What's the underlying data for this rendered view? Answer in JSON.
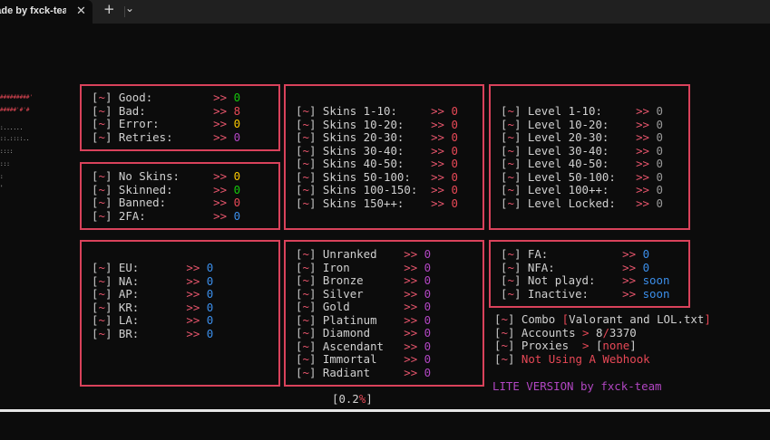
{
  "tab": {
    "title": "Tool made by fxck-team",
    "close": "✕",
    "new": "+",
    "dropdown": "⌄"
  },
  "ascii": {
    "red1": "#########'",
    "red2": "#####'#'#",
    "white": [
      ":......",
      "::.::::..",
      "::::",
      ":::",
      ":",
      "'"
    ]
  },
  "bracket_open": "[",
  "tilde": "~",
  "bracket_close": "]",
  "arrow": ">>",
  "stats": [
    {
      "label": "Good:",
      "value": "0",
      "color": "g"
    },
    {
      "label": "Bad:",
      "value": "8",
      "color": "r"
    },
    {
      "label": "Error:",
      "value": "0",
      "color": "y"
    },
    {
      "label": "Retries:",
      "value": "0",
      "color": "m"
    }
  ],
  "skins_status": [
    {
      "label": "No Skins:",
      "value": "0",
      "color": "y"
    },
    {
      "label": "Skinned:",
      "value": "0",
      "color": "g"
    },
    {
      "label": "Banned:",
      "value": "0",
      "color": "r"
    },
    {
      "label": "2FA:",
      "value": "0",
      "color": "b"
    }
  ],
  "skins": [
    {
      "label": "Skins 1-10:",
      "value": "0"
    },
    {
      "label": "Skins 10-20:",
      "value": "0"
    },
    {
      "label": "Skins 20-30:",
      "value": "0"
    },
    {
      "label": "Skins 30-40:",
      "value": "0"
    },
    {
      "label": "Skins 40-50:",
      "value": "0"
    },
    {
      "label": "Skins 50-100:",
      "value": "0"
    },
    {
      "label": "Skins 100-150:",
      "value": "0"
    },
    {
      "label": "Skins 150++:",
      "value": "0"
    }
  ],
  "levels": [
    {
      "label": "Level 1-10:",
      "value": "0"
    },
    {
      "label": "Level 10-20:",
      "value": "0"
    },
    {
      "label": "Level 20-30:",
      "value": "0"
    },
    {
      "label": "Level 30-40:",
      "value": "0"
    },
    {
      "label": "Level 40-50:",
      "value": "0"
    },
    {
      "label": "Level 50-100:",
      "value": "0"
    },
    {
      "label": "Level 100++:",
      "value": "0"
    },
    {
      "label": "Level Locked:",
      "value": "0"
    }
  ],
  "regions": [
    {
      "label": "EU:",
      "value": "0"
    },
    {
      "label": "NA:",
      "value": "0"
    },
    {
      "label": "AP:",
      "value": "0"
    },
    {
      "label": "KR:",
      "value": "0"
    },
    {
      "label": "LA:",
      "value": "0"
    },
    {
      "label": "BR:",
      "value": "0"
    }
  ],
  "ranks": [
    {
      "label": "Unranked",
      "value": "0"
    },
    {
      "label": "Iron",
      "value": "0"
    },
    {
      "label": "Bronze",
      "value": "0"
    },
    {
      "label": "Silver",
      "value": "0"
    },
    {
      "label": "Gold",
      "value": "0"
    },
    {
      "label": "Platinum",
      "value": "0"
    },
    {
      "label": "Diamond",
      "value": "0"
    },
    {
      "label": "Ascendant",
      "value": "0"
    },
    {
      "label": "Immortal",
      "value": "0"
    },
    {
      "label": "Radiant",
      "value": "0"
    }
  ],
  "access": [
    {
      "label": "FA:",
      "value": "0"
    },
    {
      "label": "NFA:",
      "value": "0"
    },
    {
      "label": "Not playd:",
      "value": "soon"
    },
    {
      "label": "Inactive:",
      "value": "soon"
    }
  ],
  "info": {
    "combo_label": "Combo",
    "combo_file": "Valorant and LOL.txt",
    "accounts_label": "Accounts",
    "gt": ">",
    "accounts_done": "8",
    "accounts_total": "3370",
    "proxies_label": "Proxies",
    "proxies_value": "none",
    "webhook": "Not Using A Webhook"
  },
  "progress": {
    "open": "[",
    "value": "0.2",
    "percent": "%",
    "close": "]"
  },
  "lite_label": "LITE VERSION by fxck-team",
  "colors": {
    "border": "#d9425b",
    "good": "#16c60c",
    "bad": "#e74856",
    "error": "#f9c700",
    "retries": "#b146c2",
    "blue": "#3b8eea"
  }
}
